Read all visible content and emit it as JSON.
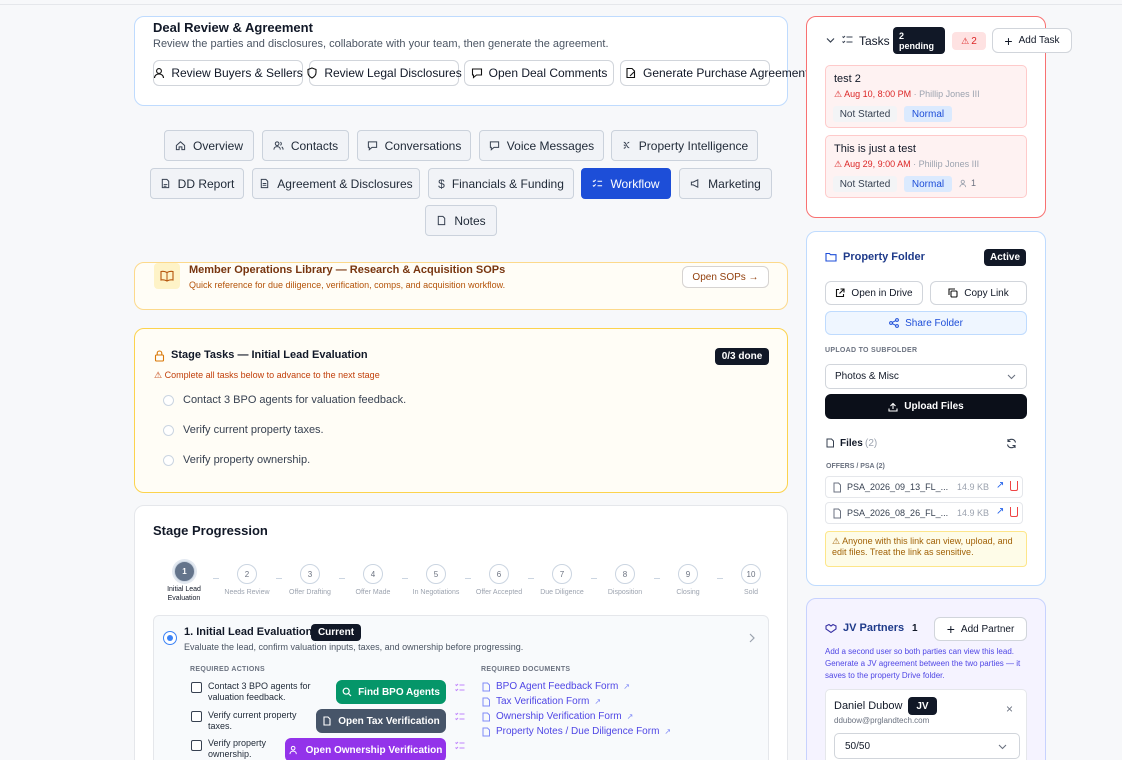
{
  "deal_review": {
    "title": "Deal Review & Agreement",
    "subtitle": "Review the parties and disclosures, collaborate with your team, then generate the agreement.",
    "buttons": [
      "Review Buyers & Sellers",
      "Review Legal Disclosures",
      "Open Deal Comments",
      "Generate Purchase Agreement"
    ]
  },
  "tabs": [
    {
      "label": "Overview",
      "icon": "home-icon"
    },
    {
      "label": "Contacts",
      "icon": "users-icon"
    },
    {
      "label": "Conversations",
      "icon": "message-icon"
    },
    {
      "label": "Voice Messages",
      "icon": "message-icon"
    },
    {
      "label": "Property Intelligence",
      "icon": "brain-icon"
    },
    {
      "label": "DD Report",
      "icon": "report-icon"
    },
    {
      "label": "Agreement & Disclosures",
      "icon": "document-icon"
    },
    {
      "label": "Financials & Funding",
      "icon": "dollar-icon"
    },
    {
      "label": "Workflow",
      "icon": "list-check-icon",
      "active": true
    },
    {
      "label": "Marketing",
      "icon": "megaphone-icon"
    },
    {
      "label": "Notes",
      "icon": "document-icon"
    }
  ],
  "sop": {
    "title": "Member Operations Library — Research & Acquisition SOPs",
    "subtitle": "Quick reference for due diligence, verification, comps, and acquisition workflow.",
    "button": "Open SOPs →"
  },
  "stage_tasks": {
    "title": "Stage Tasks — Initial Lead Evaluation",
    "badge": "0/3 done",
    "warning": "⚠ Complete all tasks below to advance to the next stage",
    "items": [
      "Contact 3 BPO agents for valuation feedback.",
      "Verify current property taxes.",
      "Verify property ownership."
    ]
  },
  "progression": {
    "title": "Stage Progression",
    "steps": [
      {
        "n": "1",
        "label": "Initial Lead Evaluation"
      },
      {
        "n": "2",
        "label": "Needs Review"
      },
      {
        "n": "3",
        "label": "Offer Drafting"
      },
      {
        "n": "4",
        "label": "Offer Made"
      },
      {
        "n": "5",
        "label": "In Negotiations"
      },
      {
        "n": "6",
        "label": "Offer Accepted"
      },
      {
        "n": "7",
        "label": "Due Diligence"
      },
      {
        "n": "8",
        "label": "Disposition"
      },
      {
        "n": "9",
        "label": "Closing"
      },
      {
        "n": "10",
        "label": "Sold"
      }
    ],
    "current": {
      "title": "1. Initial Lead Evaluation",
      "badge": "Current",
      "desc": "Evaluate the lead, confirm valuation inputs, taxes, and ownership before progressing.",
      "actions_header": "REQUIRED ACTIONS",
      "docs_header": "REQUIRED DOCUMENTS",
      "actions": [
        {
          "text": "Contact 3 BPO agents for valuation feedback.",
          "button": "Find BPO Agents",
          "color": "#059669"
        },
        {
          "text": "Verify current property taxes.",
          "button": "Open Tax Verification",
          "color": "#475569"
        },
        {
          "text": "Verify property ownership.",
          "button": "Open Ownership Verification",
          "color": "#9333ea"
        }
      ],
      "documents": [
        "BPO Agent Feedback Form",
        "Tax Verification Form",
        "Ownership Verification Form",
        "Property Notes / Due Diligence Form"
      ]
    }
  },
  "tasks": {
    "title": "Tasks",
    "pending": "2 pending",
    "alert_count": "2",
    "add_label": "Add Task",
    "items": [
      {
        "title": "test 2",
        "due": "Aug 10, 8:00 PM",
        "assignee": "· Phillip Jones III",
        "status": "Not Started",
        "priority": "Normal",
        "people": ""
      },
      {
        "title": "This is just a test",
        "due": "Aug 29, 9:00 AM",
        "assignee": "· Phillip Jones III",
        "status": "Not Started",
        "priority": "Normal",
        "people": "1"
      }
    ]
  },
  "folder": {
    "title": "Property Folder",
    "status": "Active",
    "open_drive": "Open in Drive",
    "copy_link": "Copy Link",
    "share": "Share Folder",
    "upload_label": "UPLOAD TO SUBFOLDER",
    "subfolder": "Photos & Misc",
    "upload_button": "Upload Files",
    "files_label": "Files",
    "files_count": "(2)",
    "group_label": "OFFERS / PSA (2)",
    "files": [
      {
        "name": "PSA_2026_09_13_FL_...",
        "size": "14.9 KB"
      },
      {
        "name": "PSA_2026_08_26_FL_...",
        "size": "14.9 KB"
      }
    ],
    "warning": "⚠ Anyone with this link can view, upload, and edit files. Treat the link as sensitive."
  },
  "jv": {
    "title": "JV Partners",
    "count": "1",
    "add_label": "Add Partner",
    "desc": "Add a second user so both parties can view this lead. Generate a JV agreement between the two parties — it saves to the property Drive folder.",
    "partner": {
      "name": "Daniel Dubow",
      "badge": "JV",
      "email": "ddubow@prglandtech.com",
      "split": "50/50"
    }
  }
}
